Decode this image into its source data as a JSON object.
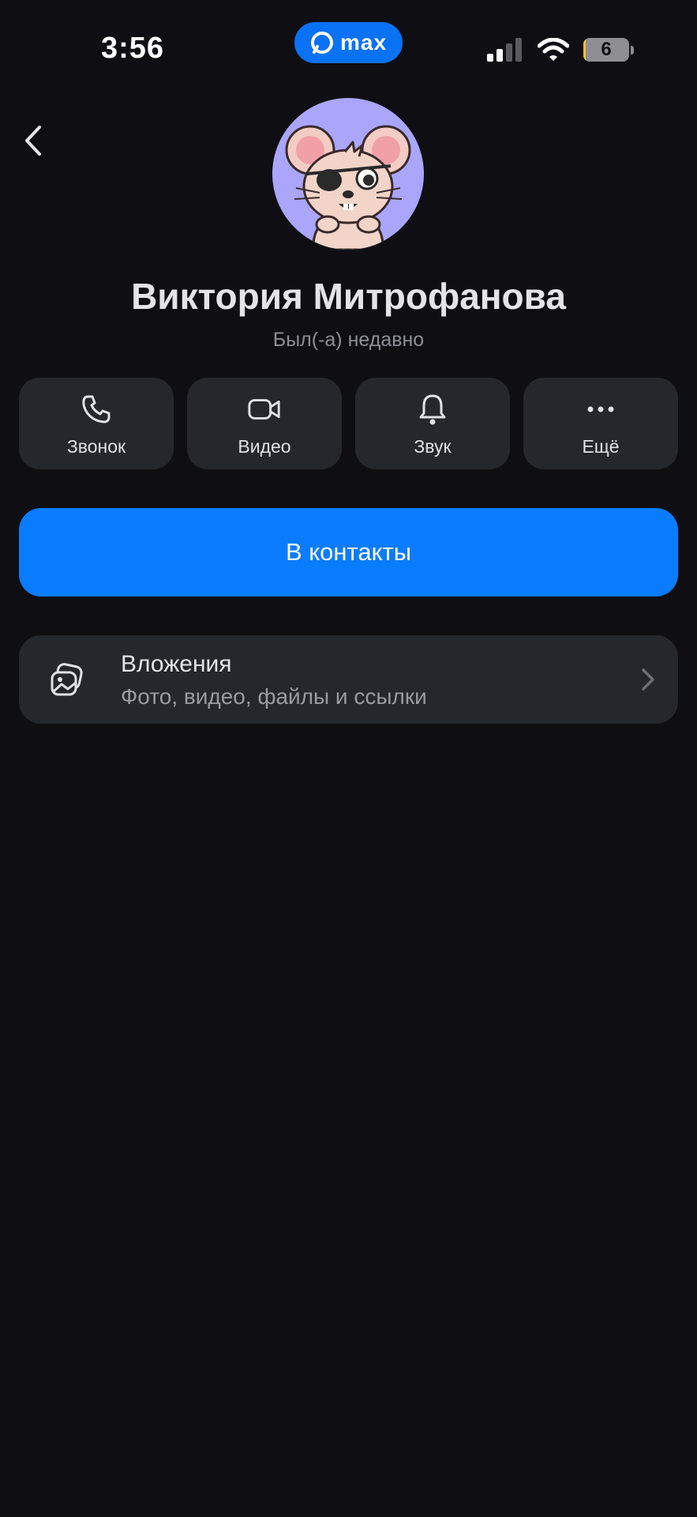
{
  "status_bar": {
    "time": "3:56",
    "app_badge": "max",
    "battery_level": "6",
    "battery_fraction": 0.06
  },
  "profile": {
    "name": "Виктория Митрофанова",
    "status": "Был(-а) недавно",
    "avatar": "mouse-pirate-avatar"
  },
  "actions": [
    {
      "label": "Звонок",
      "icon": "phone-icon"
    },
    {
      "label": "Видео",
      "icon": "video-camera-icon"
    },
    {
      "label": "Звук",
      "icon": "bell-icon"
    },
    {
      "label": "Ещё",
      "icon": "more-dots-icon"
    }
  ],
  "primary_button": {
    "label": "В контакты"
  },
  "attachments": {
    "title": "Вложения",
    "subtitle": "Фото, видео, файлы и ссылки",
    "icon": "gallery-icon"
  },
  "colors": {
    "background": "#0f0f13",
    "card": "#26272c",
    "accent": "#0a7cff"
  }
}
